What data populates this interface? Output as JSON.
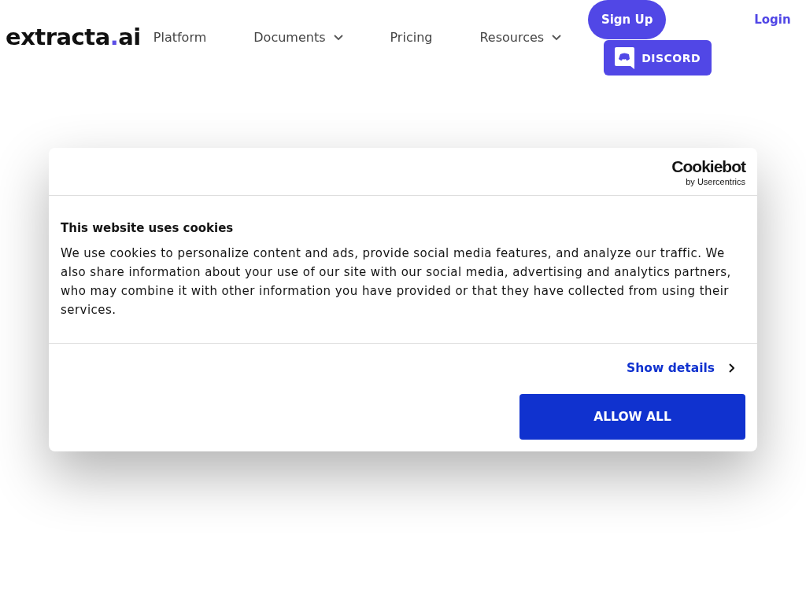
{
  "header": {
    "logo": [
      {
        "text": "extracta",
        "color": "#111111"
      },
      {
        "text": ".",
        "color": "#5b4ee6"
      },
      {
        "text": "ai",
        "color": "#111111"
      }
    ],
    "nav": [
      {
        "label": "Platform",
        "dropdown": false
      },
      {
        "label": "Documents",
        "dropdown": true
      },
      {
        "label": "Pricing",
        "dropdown": false
      },
      {
        "label": "Resources",
        "dropdown": true
      }
    ],
    "sign_up": "Sign Up",
    "discord": "DISCORD",
    "login": "Login"
  },
  "cookie_dialog": {
    "brand": "Cookiebot",
    "brand_sub": "by Usercentrics",
    "title": "This website uses cookies",
    "text": "We use cookies to personalize content and ads, provide social media features, and analyze our traffic. We also share information about your use of our site with our social media, advertising and analytics partners, who may combine it with other information you have provided or that they have collected from using their services.",
    "details_link": "Show details",
    "allow_button": "ALLOW ALL"
  }
}
